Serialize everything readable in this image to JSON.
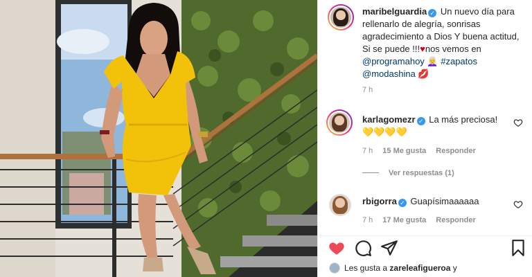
{
  "post": {
    "author": "maribelguardia",
    "caption_text": "Un nuevo día para rellenarlo de alegría, sonrisas agradecimiento a Dios Y buena actitud, Si se puede !!!",
    "caption_text2": "nos vemos en",
    "mention": "@programahoy",
    "hashtag": "#zapatos",
    "mention2": "@modashina",
    "time": "7 h"
  },
  "comments": [
    {
      "user": "karlagomezr",
      "text": "La más preciosa!",
      "emoji_line": "💛💛💛💛",
      "time": "7 h",
      "likes": "15 Me gusta",
      "reply": "Responder",
      "view_replies": "Ver respuestas (1)"
    },
    {
      "user": "rbigorra",
      "text": "Guapísimaaaaaa",
      "time": "7 h",
      "likes": "17 Me gusta",
      "reply": "Responder"
    }
  ],
  "likes_line": {
    "prefix": "Les gusta a",
    "user": "zareleafigueroa",
    "suffix": "y"
  },
  "icons": {
    "like": "heart-icon",
    "comment": "comment-icon",
    "share": "share-icon",
    "save": "bookmark-icon"
  },
  "colors": {
    "like_red": "#ed4956",
    "verified_blue": "#3897f0",
    "dress_yellow": "#f2c20a"
  }
}
